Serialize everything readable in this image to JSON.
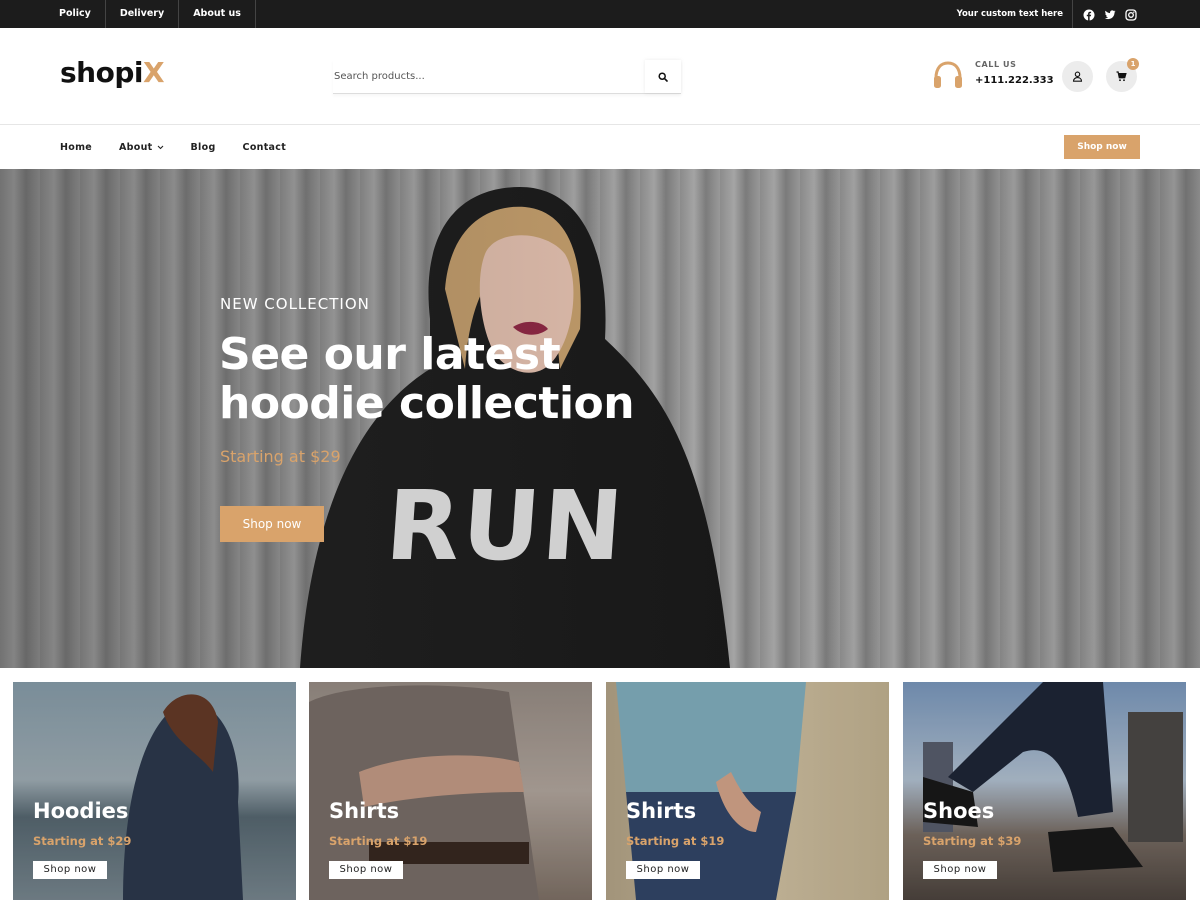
{
  "topbar": {
    "links": [
      "Policy",
      "Delivery",
      "About us"
    ],
    "custom_text": "Your custom text here",
    "social_icons": [
      "facebook-icon",
      "twitter-icon",
      "instagram-icon"
    ]
  },
  "header": {
    "logo_text": "shopi",
    "logo_accent": "X",
    "search": {
      "placeholder": "Search products..."
    },
    "call": {
      "label": "CALL US",
      "number": "+111.222.333"
    },
    "cart_count": "1"
  },
  "nav": {
    "items": [
      "Home",
      "About",
      "Blog",
      "Contact"
    ],
    "shop_button": "Shop now"
  },
  "hero": {
    "subtitle": "NEW COLLECTION",
    "title_line1": "See our latest",
    "title_line2": "hoodie collection",
    "price": "Starting at $29",
    "button": "Shop now",
    "shirt_text": "RUN"
  },
  "categories": [
    {
      "title": "Hoodies",
      "price": "Starting at $29",
      "button": "Shop now"
    },
    {
      "title": "Shirts",
      "price": "Starting at $19",
      "button": "Shop now"
    },
    {
      "title": "Shirts",
      "price": "Starting at $19",
      "button": "Shop now"
    },
    {
      "title": "Shoes",
      "price": "Starting at $39",
      "button": "Shop now"
    }
  ],
  "colors": {
    "accent": "#d9a36b",
    "topbar": "#1c1c1c",
    "text": "#222222"
  }
}
